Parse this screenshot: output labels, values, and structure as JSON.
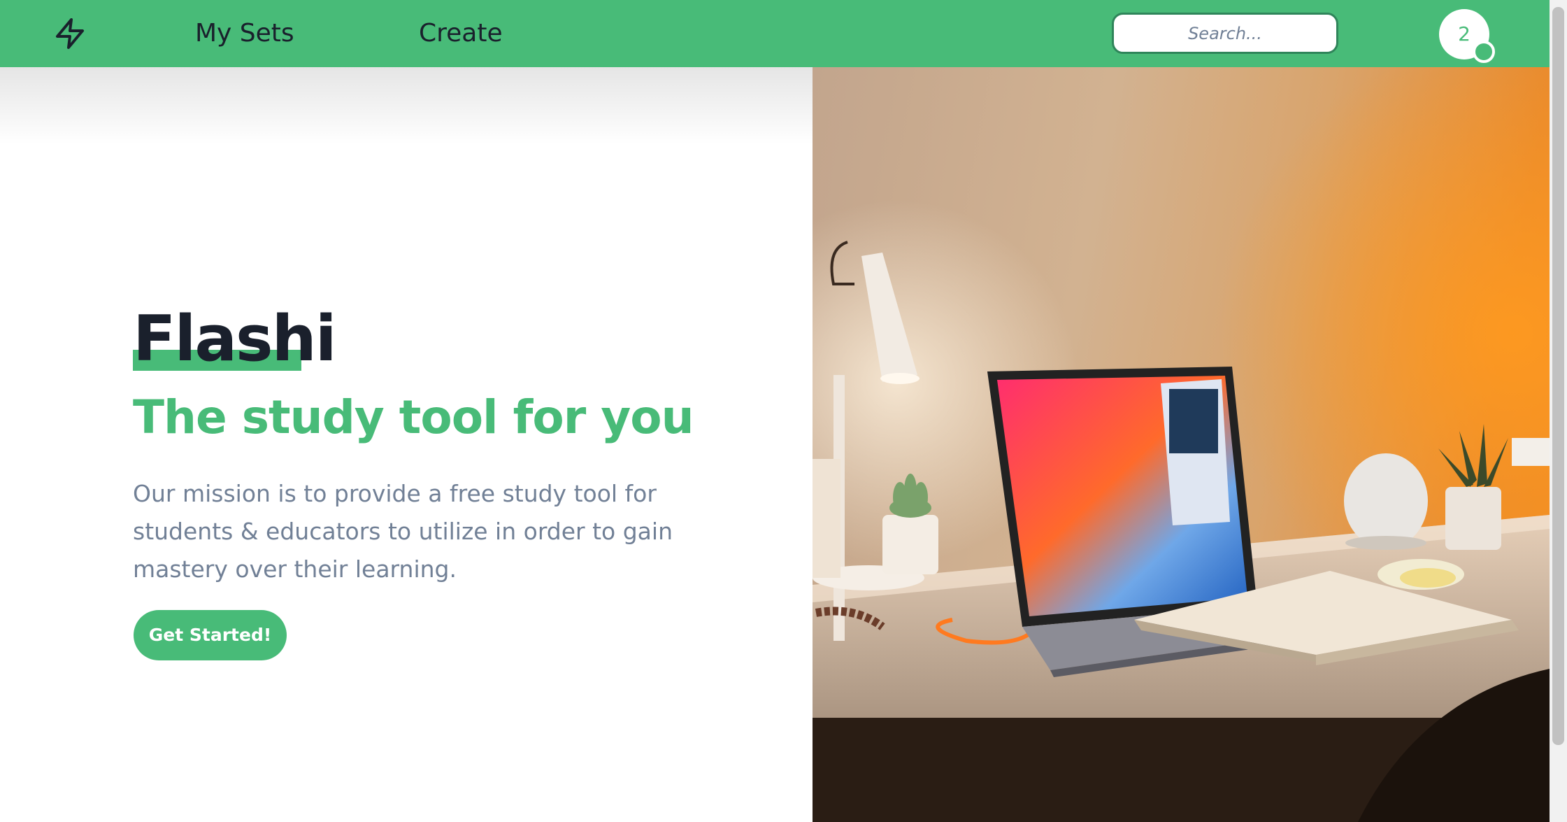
{
  "nav": {
    "logo_icon": "lightning-bolt-icon",
    "links": [
      {
        "label": "My Sets"
      },
      {
        "label": "Create"
      }
    ],
    "search": {
      "placeholder": "Search...",
      "value": ""
    },
    "avatar": {
      "text": "2"
    }
  },
  "hero": {
    "brand": "Flashi",
    "tagline": "The study tool for you",
    "mission": "Our mission is to provide a free study tool for students & educators to utilize in order to gain mastery over their learning.",
    "cta_label": "Get Started!"
  },
  "colors": {
    "accent": "#48bb78",
    "accent_dark": "#2f855a",
    "heading": "#1a202c",
    "body_text": "#718096"
  }
}
